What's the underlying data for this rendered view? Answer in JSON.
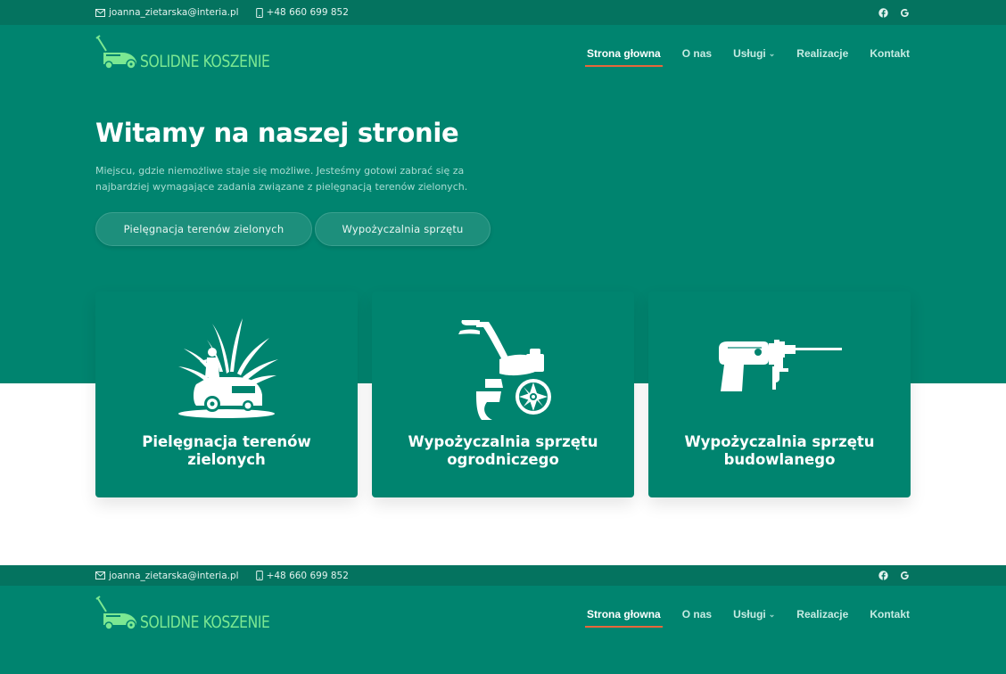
{
  "topbar": {
    "email": "joanna_zietarska@interia.pl",
    "phone": "+48 660 699 852",
    "social": [
      "facebook-icon",
      "google-icon"
    ]
  },
  "brand": {
    "logo_text": "SOLIDNE KOSZENIE"
  },
  "nav": {
    "items": [
      {
        "label": "Strona głowna",
        "active": true
      },
      {
        "label": "O nas"
      },
      {
        "label": "Usługi",
        "dropdown": true
      },
      {
        "label": "Realizacje"
      },
      {
        "label": "Kontakt"
      }
    ]
  },
  "hero": {
    "title": "Witamy na naszej stronie",
    "lead_line1": "Miejscu, gdzie niemożliwe staje się możliwe. Jesteśmy gotowi zabrać się za",
    "lead_line2": "najbardziej wymagające zadania związane z pielęgnacją terenów zielonych.",
    "buttons": [
      "Pielęgnacja terenów zielonych",
      "Wypożyczalnia sprzętu"
    ]
  },
  "cards": [
    {
      "title": "Pielęgnacja terenów zielonych",
      "icon": "lawn-mower-rider-icon"
    },
    {
      "title_line1": "Wypożyczalnia sprzętu",
      "title_line2": "ogrodniczego",
      "icon": "tiller-icon"
    },
    {
      "title_line1": "Wypożyczalnia sprzętu",
      "title_line2": "budowlanego",
      "icon": "drill-icon"
    }
  ],
  "colors": {
    "teal": "#00846f",
    "teal_dark": "#04735f",
    "accent": "#e8663a",
    "logo_green": "#7be892"
  }
}
